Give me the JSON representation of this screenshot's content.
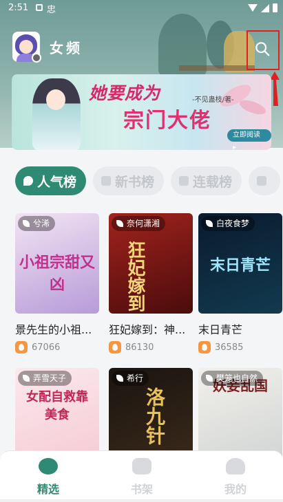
{
  "status_bar": {
    "time": "2:51",
    "extra_glyph": "忠"
  },
  "header": {
    "channel_title": "女频"
  },
  "banner": {
    "title_line1": "她要成为",
    "author": "-不见蛊枝/著-",
    "title_line2": "宗门大佬",
    "read_button": "立即阅读 ▸"
  },
  "tabs": [
    {
      "label": "人气榜",
      "active": true
    },
    {
      "label": "新书榜",
      "active": false
    },
    {
      "label": "连载榜",
      "active": false
    },
    {
      "label": "",
      "active": false
    }
  ],
  "books": [
    {
      "tag": "兮浠",
      "title": "景先生的小祖...",
      "heat": "67066",
      "cover_text": "小祖宗甜又凶",
      "cover_colors": [
        "#f2e4f3",
        "#b79bd8"
      ],
      "cover_text_color": "#c0318e"
    },
    {
      "tag": "奈何潇湘",
      "title": "狂妃嫁到：神...",
      "heat": "86130",
      "cover_text": "狂妃嫁到",
      "cover_colors": [
        "#a2231d",
        "#4a0c0c"
      ],
      "cover_text_color": "#f3d57a"
    },
    {
      "tag": "白夜食梦",
      "title": "末日青芒",
      "heat": "36585",
      "cover_text": "末日青芒",
      "cover_colors": [
        "#0a1a2e",
        "#123a4f"
      ],
      "cover_text_color": "#9fe6ff"
    },
    {
      "tag": "弄雪天子",
      "title": "",
      "heat": "",
      "cover_text": "女配自救靠美食",
      "cover_colors": [
        "#fbe9ee",
        "#f6c9d3"
      ],
      "cover_text_color": "#c32755"
    },
    {
      "tag": "希行",
      "title": "",
      "heat": "",
      "cover_text": "洛九针",
      "cover_colors": [
        "#1a1410",
        "#3b2a1a"
      ],
      "cover_text_color": "#e8c15a"
    },
    {
      "tag": "樊笼也自然",
      "title": "",
      "heat": "",
      "cover_text": "妖妾乱国",
      "cover_colors": [
        "#f2f0ea",
        "#cfd3d3"
      ],
      "cover_text_color": "#7b1f1f"
    }
  ],
  "bottom_nav": [
    {
      "label": "精选",
      "active": true
    },
    {
      "label": "书架",
      "active": false
    },
    {
      "label": "我的",
      "active": false
    }
  ],
  "colors": {
    "accent": "#2e8a72",
    "annotation_red": "#e02020",
    "heat_orange": "#f89540"
  }
}
